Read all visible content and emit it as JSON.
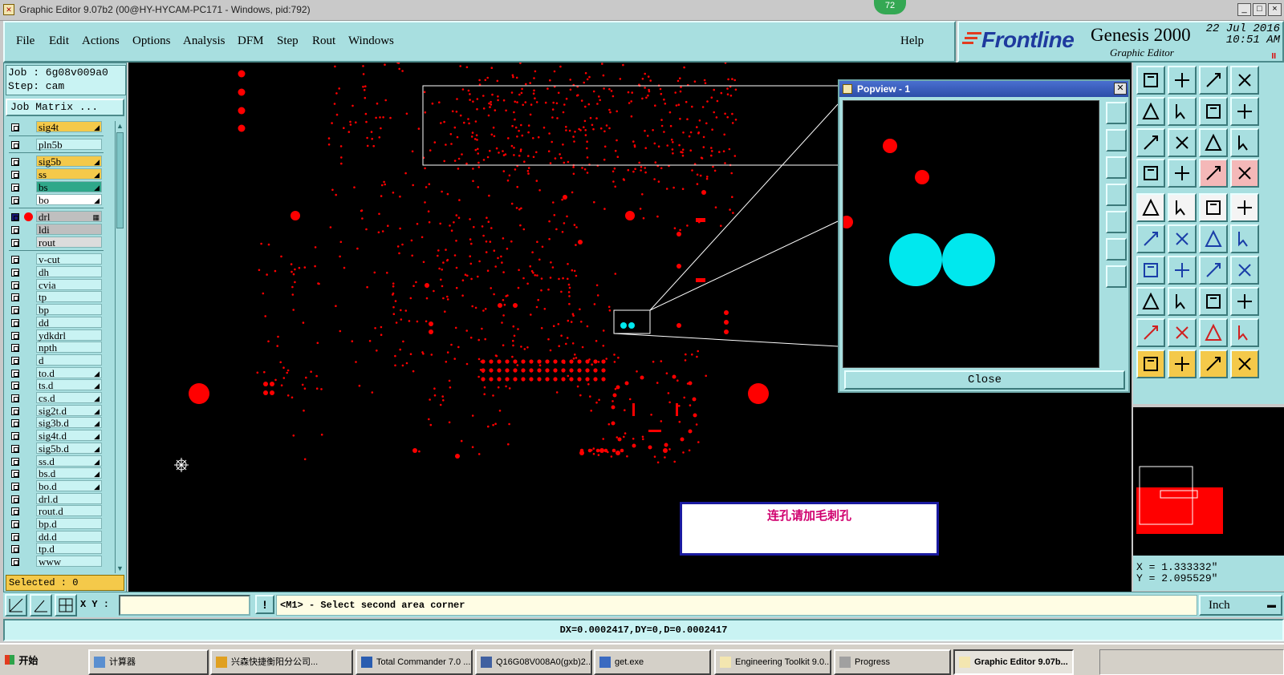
{
  "window": {
    "title": "Graphic Editor 9.07b2 (00@HY-HYCAM-PC171 - Windows, pid:792)",
    "badge": "72",
    "controls": [
      "_",
      "□",
      "×"
    ]
  },
  "menu": {
    "items": [
      "File",
      "Edit",
      "Actions",
      "Options",
      "Analysis",
      "DFM",
      "Step",
      "Rout",
      "Windows"
    ],
    "help": "Help"
  },
  "brand": {
    "logo": "Frontline",
    "product": "Genesis 2000",
    "subtitle": "Graphic Editor",
    "date": "22 Jul 2016",
    "time": "10:51 AM",
    "pause": "II"
  },
  "job": {
    "job_line": "Job : 6g08v009a0",
    "step_line": "Step: cam",
    "matrix_button": "Job Matrix ..."
  },
  "layers": [
    {
      "name": "sig4t",
      "color": "#f4c94a",
      "mark": "◢",
      "group": 1
    },
    {
      "name": "pln5b",
      "color": "#c9f3f3",
      "mark": "",
      "group": 2
    },
    {
      "name": "sig5b",
      "color": "#f4c94a",
      "mark": "◢",
      "group": 3
    },
    {
      "name": "ss",
      "color": "#f4c94a",
      "mark": "◢",
      "group": 3
    },
    {
      "name": "bs",
      "color": "#2fa88a",
      "mark": "◢",
      "group": 3
    },
    {
      "name": "bo",
      "color": "#ffffff",
      "mark": "◢",
      "group": 3
    },
    {
      "name": "drl",
      "color": "#bfbfbf",
      "mark": "▦",
      "group": 4,
      "active": true
    },
    {
      "name": "ldi",
      "color": "#bfbfbf",
      "mark": "",
      "group": 4
    },
    {
      "name": "rout",
      "color": "#dcdcdc",
      "mark": "",
      "group": 4
    },
    {
      "name": "v-cut",
      "color": "#c9f3f3",
      "mark": "",
      "group": 5
    },
    {
      "name": "dh",
      "color": "#c9f3f3",
      "mark": "",
      "group": 5
    },
    {
      "name": "cvia",
      "color": "#c9f3f3",
      "mark": "",
      "group": 5
    },
    {
      "name": "tp",
      "color": "#c9f3f3",
      "mark": "",
      "group": 5
    },
    {
      "name": "bp",
      "color": "#c9f3f3",
      "mark": "",
      "group": 5
    },
    {
      "name": "dd",
      "color": "#c9f3f3",
      "mark": "",
      "group": 5
    },
    {
      "name": "ydkdrl",
      "color": "#c9f3f3",
      "mark": "",
      "group": 5
    },
    {
      "name": "npth",
      "color": "#c9f3f3",
      "mark": "",
      "group": 5
    },
    {
      "name": "d",
      "color": "#c9f3f3",
      "mark": "",
      "group": 5
    },
    {
      "name": "to.d",
      "color": "#c9f3f3",
      "mark": "◢",
      "group": 5
    },
    {
      "name": "ts.d",
      "color": "#c9f3f3",
      "mark": "◢",
      "group": 5
    },
    {
      "name": "cs.d",
      "color": "#c9f3f3",
      "mark": "◢",
      "group": 5
    },
    {
      "name": "sig2t.d",
      "color": "#c9f3f3",
      "mark": "◢",
      "group": 5
    },
    {
      "name": "sig3b.d",
      "color": "#c9f3f3",
      "mark": "◢",
      "group": 5
    },
    {
      "name": "sig4t.d",
      "color": "#c9f3f3",
      "mark": "◢",
      "group": 5
    },
    {
      "name": "sig5b.d",
      "color": "#c9f3f3",
      "mark": "◢",
      "group": 5
    },
    {
      "name": "ss.d",
      "color": "#c9f3f3",
      "mark": "◢",
      "group": 5
    },
    {
      "name": "bs.d",
      "color": "#c9f3f3",
      "mark": "◢",
      "group": 5
    },
    {
      "name": "bo.d",
      "color": "#c9f3f3",
      "mark": "◢",
      "group": 5
    },
    {
      "name": "drl.d",
      "color": "#c9f3f3",
      "mark": "",
      "group": 5
    },
    {
      "name": "rout.d",
      "color": "#c9f3f3",
      "mark": "",
      "group": 5
    },
    {
      "name": "bp.d",
      "color": "#c9f3f3",
      "mark": "",
      "group": 5
    },
    {
      "name": "dd.d",
      "color": "#c9f3f3",
      "mark": "",
      "group": 5
    },
    {
      "name": "tp.d",
      "color": "#c9f3f3",
      "mark": "",
      "group": 5
    },
    {
      "name": "www",
      "color": "#c9f3f3",
      "mark": "",
      "group": 5
    }
  ],
  "selected": "Selected : 0",
  "popview": {
    "title": "Popview - 1",
    "close": "Close"
  },
  "note": {
    "text": "连孔请加毛刺孔"
  },
  "coords": {
    "x": "X = 1.333332\"",
    "y": "Y = 2.095529\""
  },
  "command": {
    "xy_label": "X Y :",
    "xy_value": "",
    "warn": "!",
    "prompt": "<M1> - Select second area corner",
    "unit": "Inch"
  },
  "status": "DX=0.0002417,DY=0,D=0.0002417",
  "colors": {
    "panel": "#a8dfe0",
    "drill": "#ff0000",
    "highlight": "#00e8ee"
  },
  "taskbar": {
    "start": "开始",
    "tasks": [
      {
        "label": "计算器"
      },
      {
        "label": "兴森快捷衡阳分公司..."
      },
      {
        "label": "Total Commander 7.0 ..."
      },
      {
        "label": "Q16G08V008A0(gxb)2..."
      },
      {
        "label": "get.exe"
      },
      {
        "label": "Engineering Toolkit 9.0..."
      },
      {
        "label": "Progress"
      },
      {
        "label": "Graphic Editor 9.07b...",
        "active": true
      }
    ]
  }
}
